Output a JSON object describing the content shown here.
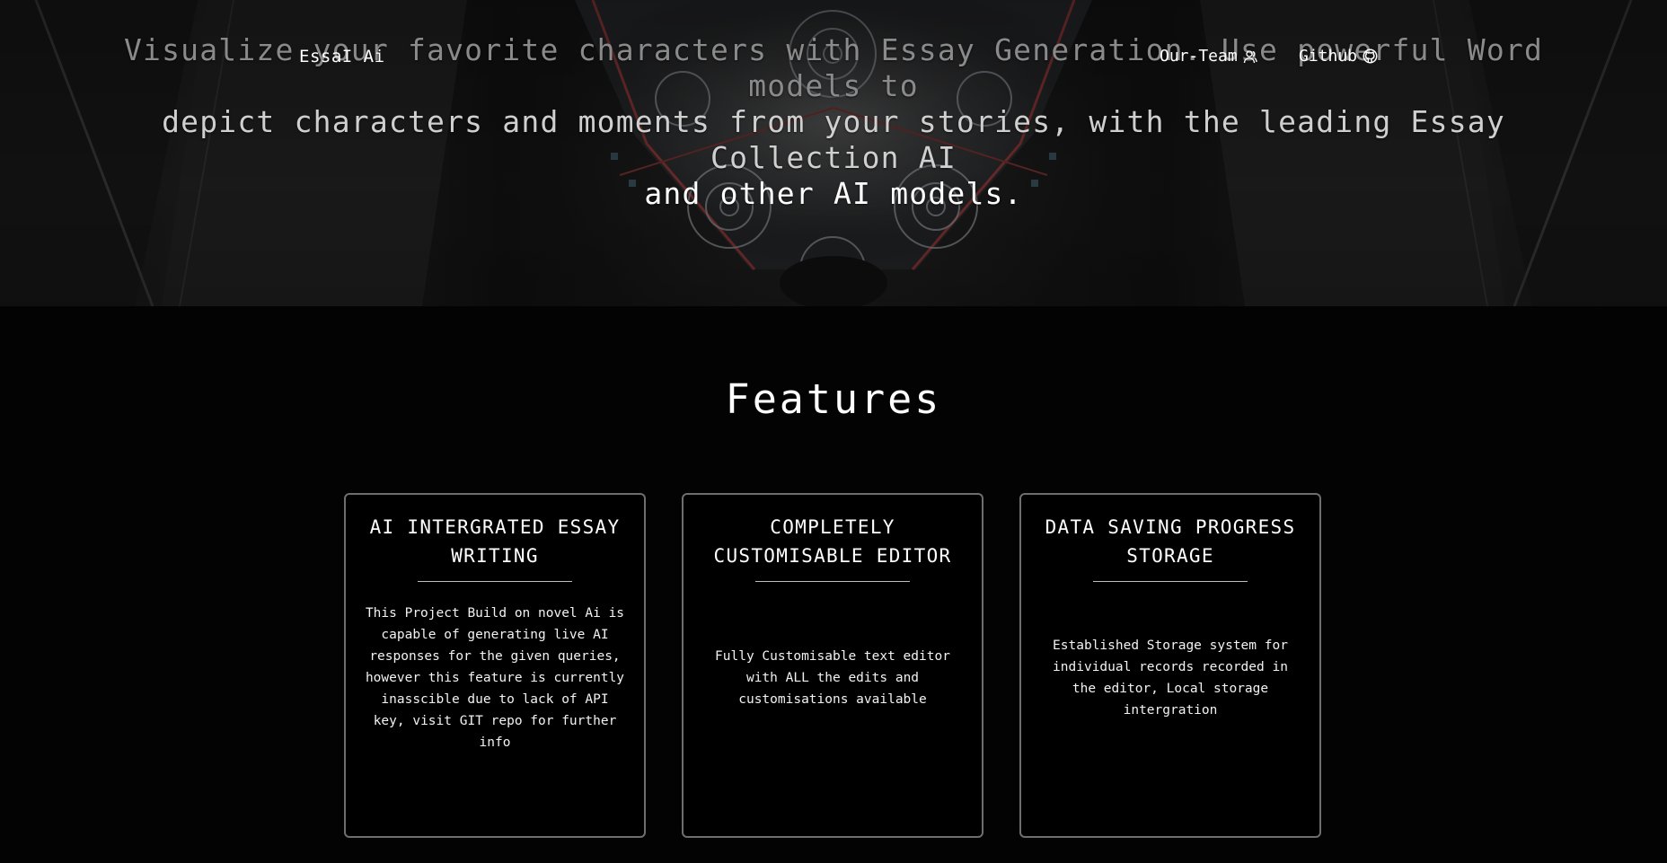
{
  "nav": {
    "brand": "EssaI Ai",
    "team_label": "Our-Team",
    "team_icon": "team-icon",
    "github_label": "Github",
    "github_icon": "github-icon"
  },
  "hero": {
    "line_1_part_1": "Visualize your favorite characters with Essay Generation. Use powerful Word models to",
    "line_2": "depict characters and moments from your stories, with the leading Essay Collection AI",
    "line_3": "and other AI models."
  },
  "features": {
    "title": "Features",
    "cards": [
      {
        "title": "AI INTERGRATED ESSAY WRITING",
        "text": "This Project Build on novel Ai is capable of generating live AI responses for the given queries, however this feature is currently inasscible due to lack of API key, visit GIT repo for further info"
      },
      {
        "title": "COMPLETELY CUSTOMISABLE EDITOR",
        "text": "Fully Customisable text editor with ALL the edits and customisations available"
      },
      {
        "title": "DATA SAVING PROGRESS STORAGE",
        "text": "Established Storage system for individual records recorded in the editor, Local storage intergration"
      }
    ]
  },
  "colors": {
    "background": "#030303",
    "text": "#ffffff",
    "card_border": "#6e6e6e",
    "dim_text": "#8a8a8a"
  }
}
